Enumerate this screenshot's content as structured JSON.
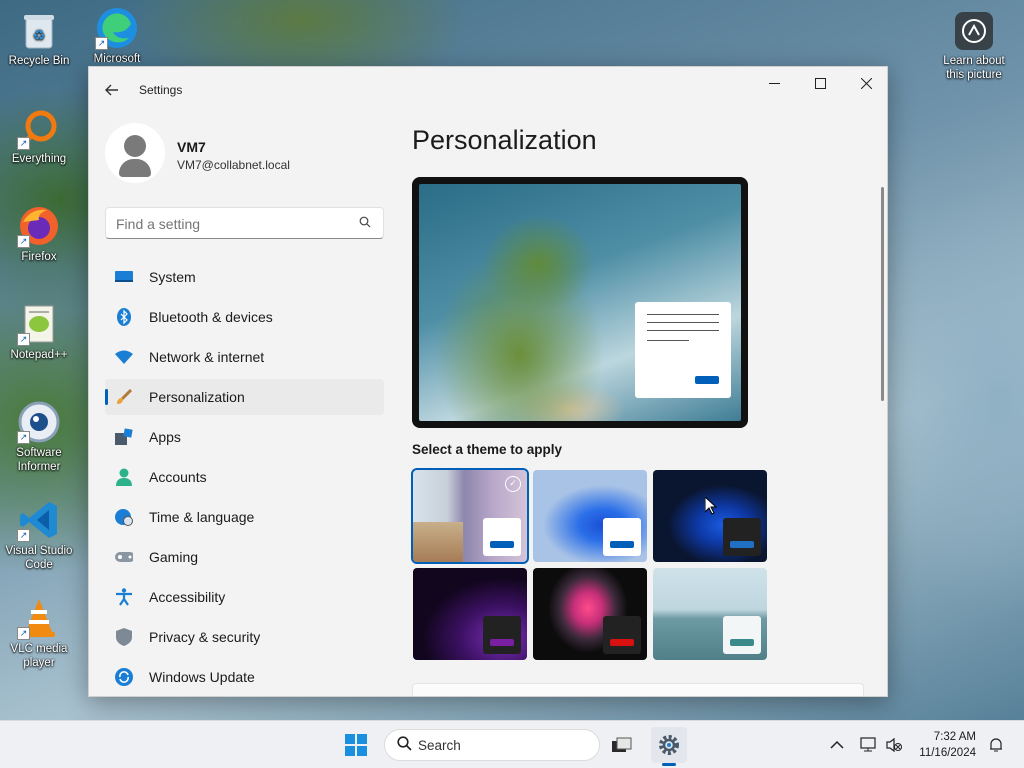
{
  "desktop": {
    "icons": [
      {
        "label": "Recycle Bin"
      },
      {
        "label": "Microsoft Edge"
      },
      {
        "label": "Everything"
      },
      {
        "label": "Firefox"
      },
      {
        "label": "Notepad++"
      },
      {
        "label": "Software Informer"
      },
      {
        "label": "Visual Studio Code"
      },
      {
        "label": "VLC media player"
      }
    ],
    "learn_about": "Learn about this picture"
  },
  "window": {
    "title": "Settings",
    "controls": {
      "minimize": "—",
      "maximize": "☐",
      "close": "✕"
    }
  },
  "user": {
    "name": "VM7",
    "email": "VM7@collabnet.local"
  },
  "search": {
    "placeholder": "Find a setting"
  },
  "sidebar": {
    "items": [
      {
        "label": "System",
        "icon": "system-icon",
        "active": false
      },
      {
        "label": "Bluetooth & devices",
        "icon": "bluetooth-icon",
        "active": false
      },
      {
        "label": "Network & internet",
        "icon": "wifi-icon",
        "active": false
      },
      {
        "label": "Personalization",
        "icon": "brush-icon",
        "active": true
      },
      {
        "label": "Apps",
        "icon": "apps-icon",
        "active": false
      },
      {
        "label": "Accounts",
        "icon": "accounts-icon",
        "active": false
      },
      {
        "label": "Time & language",
        "icon": "globe-clock-icon",
        "active": false
      },
      {
        "label": "Gaming",
        "icon": "gamepad-icon",
        "active": false
      },
      {
        "label": "Accessibility",
        "icon": "accessibility-icon",
        "active": false
      },
      {
        "label": "Privacy & security",
        "icon": "shield-icon",
        "active": false
      },
      {
        "label": "Windows Update",
        "icon": "update-icon",
        "active": false
      }
    ]
  },
  "main": {
    "title": "Personalization",
    "theme_section_label": "Select a theme to apply",
    "themes": [
      {
        "name": "theme-1",
        "selected": true,
        "accent": "#005fb8"
      },
      {
        "name": "theme-2",
        "selected": false,
        "accent": "#005fb8"
      },
      {
        "name": "theme-3",
        "selected": false,
        "accent": "#1f6fc4"
      },
      {
        "name": "theme-4",
        "selected": false,
        "accent": "#7a1fa2"
      },
      {
        "name": "theme-5",
        "selected": false,
        "accent": "#d81010"
      },
      {
        "name": "theme-6",
        "selected": false,
        "accent": "#3a8a8c"
      }
    ]
  },
  "taskbar": {
    "search_label": "Search",
    "time": "7:32 AM",
    "date": "11/16/2024"
  },
  "colors": {
    "accent": "#005fb8",
    "window_bg": "#f3f3f3",
    "taskbar_bg": "#eef0f4"
  }
}
